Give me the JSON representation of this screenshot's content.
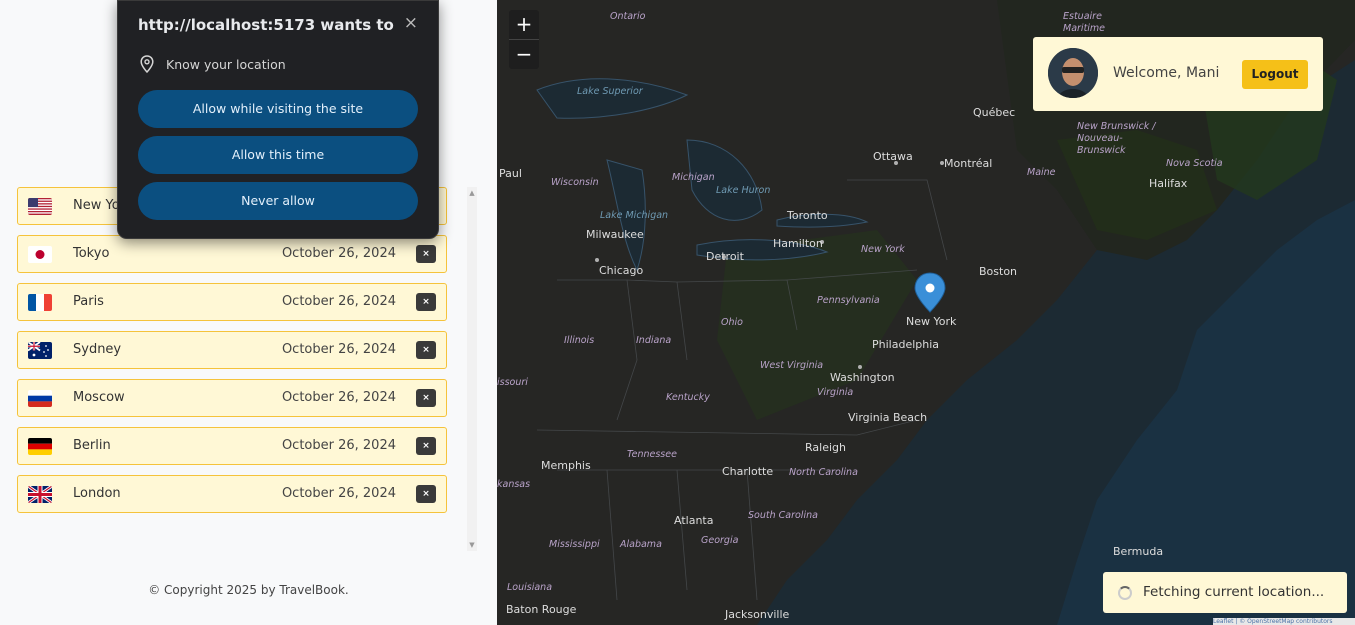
{
  "sidebar": {
    "cities": [
      {
        "name": "New Yo",
        "date": "",
        "delete": "×",
        "flag": "us"
      },
      {
        "name": "Tokyo",
        "date": "October 26, 2024",
        "delete": "×",
        "flag": "jp"
      },
      {
        "name": "Paris",
        "date": "October 26, 2024",
        "delete": "×",
        "flag": "fr"
      },
      {
        "name": "Sydney",
        "date": "October 26, 2024",
        "delete": "×",
        "flag": "au"
      },
      {
        "name": "Moscow",
        "date": "October 26, 2024",
        "delete": "×",
        "flag": "ru"
      },
      {
        "name": "Berlin",
        "date": "October 26, 2024",
        "delete": "×",
        "flag": "de"
      },
      {
        "name": "London",
        "date": "October 26, 2024",
        "delete": "×",
        "flag": "gb"
      }
    ],
    "copyright": "© Copyright 2025 by TravelBook."
  },
  "map": {
    "zoom_in": "+",
    "zoom_out": "−",
    "labels": {
      "ontario": "Ontario",
      "lake_superior": "Lake Superior",
      "quebec": "Québec",
      "ottawa": "Ottawa",
      "montreal": "Montréal",
      "paul": "Paul",
      "wisconsin": "Wisconsin",
      "michigan": "Michigan",
      "lake_huron": "Lake Huron",
      "lake_michigan": "Lake Michigan",
      "milwaukee": "Milwaukee",
      "toronto": "Toronto",
      "hamilton": "Hamilton",
      "detroit": "Detroit",
      "chicago": "Chicago",
      "new_york_state": "New York",
      "boston": "Boston",
      "maine": "Maine",
      "halifax": "Halifax",
      "nova_scotia": "Nova Scotia",
      "new_brunswick": "New Brunswick / Nouveau-Brunswick",
      "estuaire": "Estuaire Maritime",
      "pennsylvania": "Pennsylvania",
      "new_york_city": "New York",
      "philadelphia": "Philadelphia",
      "ohio": "Ohio",
      "illinois": "Illinois",
      "indiana": "Indiana",
      "west_virginia": "West Virginia",
      "washington": "Washington",
      "virginia": "Virginia",
      "missouri": "issouri",
      "kentucky": "Kentucky",
      "virginia_beach": "Virginia Beach",
      "raleigh": "Raleigh",
      "memphis": "Memphis",
      "tennessee": "Tennessee",
      "charlotte": "Charlotte",
      "north_carolina": "North Carolina",
      "kansas": "kansas",
      "atlanta": "Atlanta",
      "south_carolina": "South Carolina",
      "mississippi": "Mississippi",
      "alabama": "Alabama",
      "georgia": "Georgia",
      "louisiana": "Louisiana",
      "baton_rouge": "Baton Rouge",
      "jacksonville": "Jacksonville",
      "bermuda": "Bermuda"
    },
    "attribution": "Leaflet | © OpenStreetMap contributors"
  },
  "user": {
    "welcome": "Welcome, Mani",
    "logout": "Logout"
  },
  "toast": {
    "text": "Fetching current location..."
  },
  "permission_popup": {
    "title": "http://localhost:5173 wants to",
    "close": "×",
    "permission": "Know your location",
    "allow_visiting": "Allow while visiting the site",
    "allow_once": "Allow this time",
    "never": "Never allow"
  },
  "colors": {
    "accent": "#f5c018",
    "item_bg": "#fff8d6",
    "map_water": "#1a2730",
    "popup_button": "#0b4f80"
  }
}
